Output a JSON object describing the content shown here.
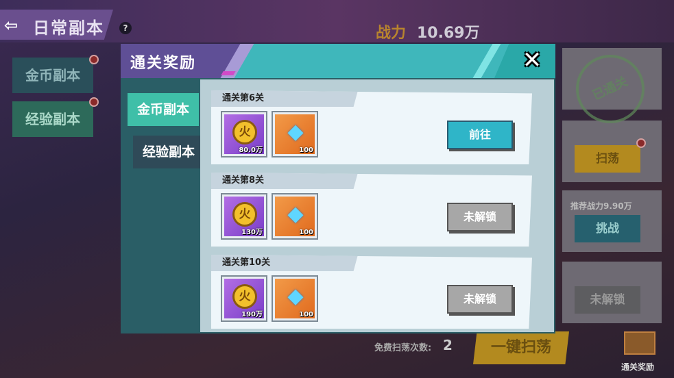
{
  "background": {
    "title": "日常副本",
    "help_icon": "?",
    "power_label": "战力",
    "power_value": "10.69万",
    "side_tabs": [
      "金币副本",
      "经验副本"
    ],
    "cleared_stamp": "已通关",
    "sweep_label": "扫荡",
    "recommended_power": "推荐战力9.90万",
    "challenge_label": "挑战",
    "locked_label": "未解锁",
    "free_sweep_label": "免费扫荡次数:",
    "free_sweep_count": "2",
    "one_key_sweep": "一键扫荡",
    "clear_reward_label": "通关奖励"
  },
  "modal": {
    "title": "通关奖励",
    "close_icon": "✕",
    "tabs": [
      {
        "label": "金币副本",
        "active": true
      },
      {
        "label": "经验副本",
        "active": false
      }
    ],
    "rewards": [
      {
        "label": "通关第6关",
        "coin_icon": "火",
        "coin_qty": "80.0万",
        "gem_qty": "100",
        "button": "前往",
        "state": "go"
      },
      {
        "label": "通关第8关",
        "coin_icon": "火",
        "coin_qty": "130万",
        "gem_qty": "100",
        "button": "未解锁",
        "state": "locked"
      },
      {
        "label": "通关第10关",
        "coin_icon": "火",
        "coin_qty": "190万",
        "gem_qty": "100",
        "button": "未解锁",
        "state": "locked"
      }
    ]
  },
  "colors": {
    "header_teal": "#3fb7bb",
    "header_purple": "#5f4f96",
    "tab_active": "#3fbfa8",
    "go_button": "#2fb5c8",
    "locked_button": "#a7a7a7"
  }
}
